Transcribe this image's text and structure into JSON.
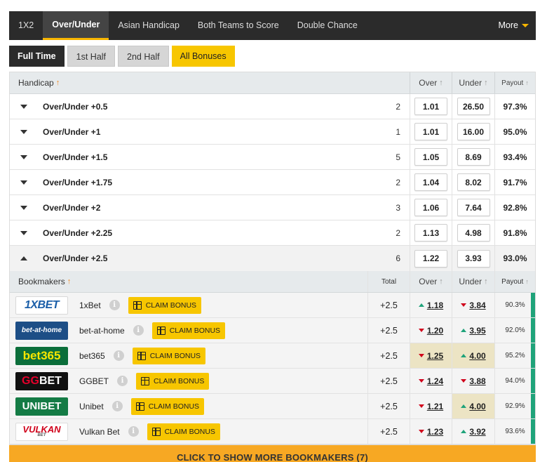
{
  "nav": {
    "items": [
      "1X2",
      "Over/Under",
      "Asian Handicap",
      "Both Teams to Score",
      "Double Chance"
    ],
    "active": "Over/Under",
    "more_label": "More"
  },
  "periods": [
    {
      "label": "Full Time",
      "style": "dark"
    },
    {
      "label": "1st Half",
      "style": "grey"
    },
    {
      "label": "2nd Half",
      "style": "grey"
    },
    {
      "label": "All Bonuses",
      "style": "yellow"
    }
  ],
  "table": {
    "headers": {
      "handicap": "Handicap",
      "over": "Over",
      "under": "Under",
      "payout": "Payout"
    },
    "markets": [
      {
        "name": "Over/Under +0.5",
        "count": "2",
        "over": "1.01",
        "under": "26.50",
        "payout": "97.3%"
      },
      {
        "name": "Over/Under +1",
        "count": "1",
        "over": "1.01",
        "under": "16.00",
        "payout": "95.0%"
      },
      {
        "name": "Over/Under +1.5",
        "count": "5",
        "over": "1.05",
        "under": "8.69",
        "payout": "93.4%"
      },
      {
        "name": "Over/Under +1.75",
        "count": "2",
        "over": "1.04",
        "under": "8.02",
        "payout": "91.7%"
      },
      {
        "name": "Over/Under +2",
        "count": "3",
        "over": "1.06",
        "under": "7.64",
        "payout": "92.8%"
      },
      {
        "name": "Over/Under +2.25",
        "count": "2",
        "over": "1.13",
        "under": "4.98",
        "payout": "91.8%"
      },
      {
        "name": "Over/Under +2.5",
        "count": "6",
        "over": "1.22",
        "under": "3.93",
        "payout": "93.0%"
      }
    ]
  },
  "bookmakers": {
    "headers": {
      "name": "Bookmakers",
      "total": "Total",
      "over": "Over",
      "under": "Under",
      "payout": "Payout"
    },
    "claim_label": "CLAIM BONUS",
    "rows": [
      {
        "logo": "1XBET",
        "name": "1xBet",
        "total": "+2.5",
        "over": "1.18",
        "over_dir": "up",
        "under": "3.84",
        "under_dir": "down",
        "payout": "90.3%",
        "hl_over": false,
        "hl_under": false
      },
      {
        "logo": "bet-at-home",
        "name": "bet-at-home",
        "total": "+2.5",
        "over": "1.20",
        "over_dir": "down",
        "under": "3.95",
        "under_dir": "up",
        "payout": "92.0%",
        "hl_over": false,
        "hl_under": false
      },
      {
        "logo": "bet365",
        "name": "bet365",
        "total": "+2.5",
        "over": "1.25",
        "over_dir": "down",
        "under": "4.00",
        "under_dir": "up",
        "payout": "95.2%",
        "hl_over": true,
        "hl_under": true
      },
      {
        "logo": "GGBET",
        "name": "GGBET",
        "total": "+2.5",
        "over": "1.24",
        "over_dir": "down",
        "under": "3.88",
        "under_dir": "down",
        "payout": "94.0%",
        "hl_over": false,
        "hl_under": false
      },
      {
        "logo": "UNIBET",
        "name": "Unibet",
        "total": "+2.5",
        "over": "1.21",
        "over_dir": "down",
        "under": "4.00",
        "under_dir": "up",
        "payout": "92.9%",
        "hl_over": false,
        "hl_under": true
      },
      {
        "logo": "VULKAN",
        "name": "Vulkan Bet",
        "total": "+2.5",
        "over": "1.23",
        "over_dir": "down",
        "under": "3.92",
        "under_dir": "up",
        "payout": "93.6%",
        "hl_over": false,
        "hl_under": false
      }
    ],
    "logo_sub": {
      "vulkan": "BET"
    },
    "show_more": "CLICK TO SHOW MORE BOOKMAKERS (7)"
  },
  "colors": {
    "accent_yellow": "#f7c600",
    "nav_dark": "#2b2b2b",
    "odds_up": "#1fa37a",
    "odds_down": "#d0021b",
    "show_more_bg": "#f7a823"
  }
}
